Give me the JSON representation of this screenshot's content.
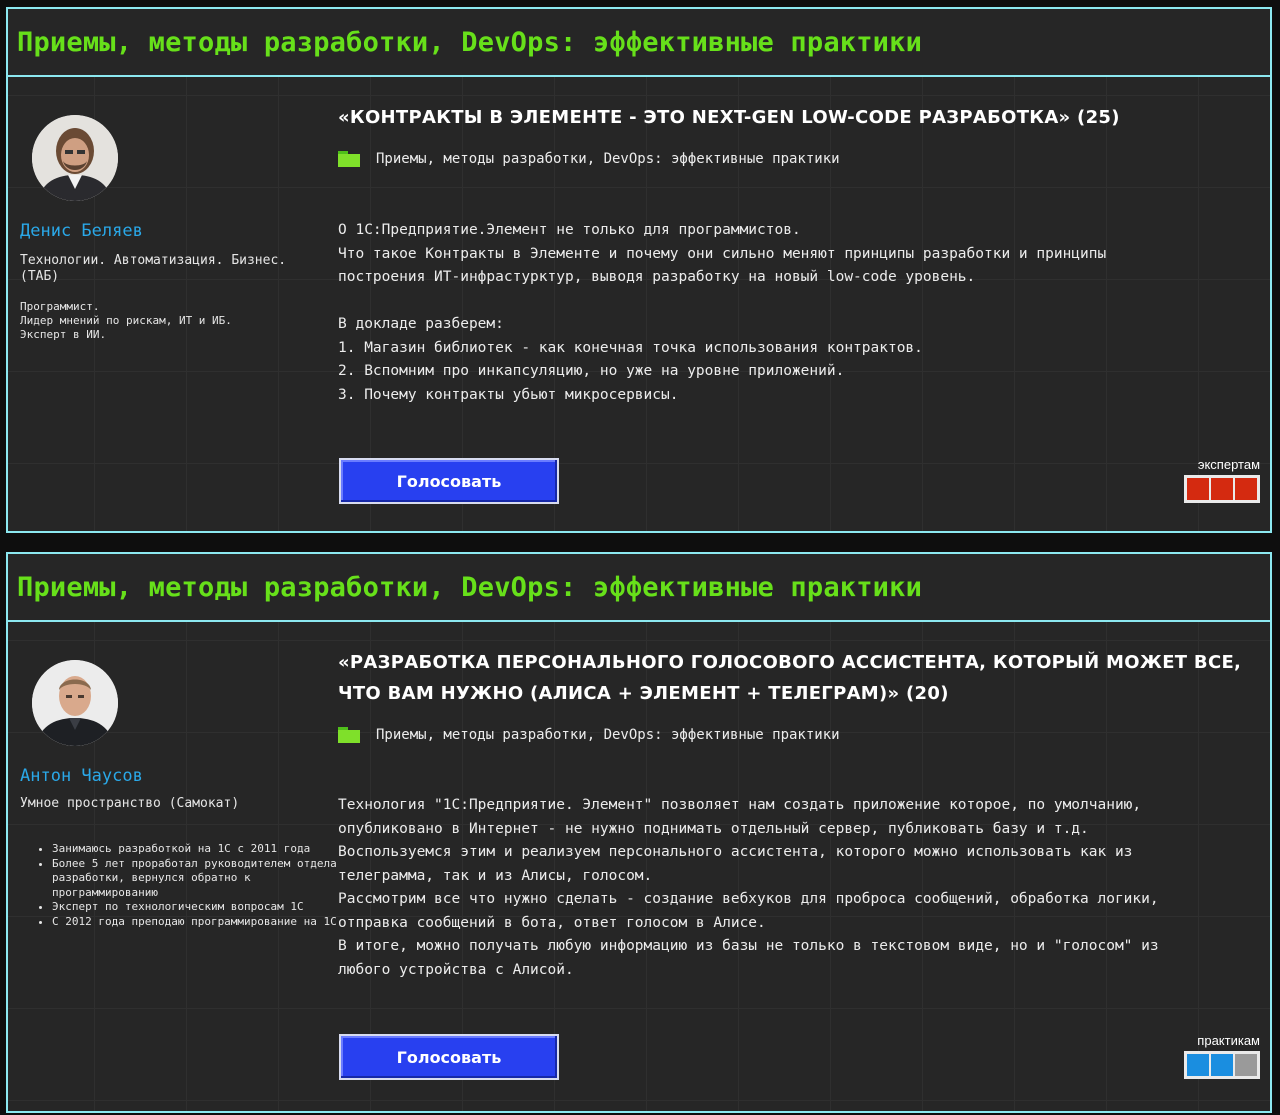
{
  "cards": [
    {
      "header": "Приемы, методы разработки, DevOps: эффективные практики",
      "speaker": {
        "name": "Денис Беляев",
        "company": "Технологии. Автоматизация. Бизнес. (ТАБ)",
        "bio_lines": [
          "Программист.",
          "Лидер мнений по рискам, ИТ и ИБ.",
          "Эксперт в ИИ."
        ]
      },
      "talk": {
        "title": "«КОНТРАКТЫ В ЭЛЕМЕНТЕ - ЭТО NEXT-GEN LOW-CODE РАЗРАБОТКА» (25)",
        "category": "Приемы, методы разработки, DevOps: эффективные практики",
        "description": [
          "О 1С:Предприятие.Элемент не только для программистов.",
          "Что такое Контракты в Элементе и почему они сильно меняют принципы разработки и принципы",
          "построения ИТ-инфрастурктур, выводя разработку на новый low-code уровень.",
          "",
          "В докладе разберем:",
          "1. Магазин библиотек - как конечная точка использования контрактов.",
          "2. Вспомним про инкапсуляцию, но уже на уровне приложений.",
          "3. Почему контракты убьют микросервисы."
        ]
      },
      "vote_label": "Голосовать",
      "rating": {
        "label": "экспертам",
        "colors": [
          "#d42a10",
          "#d42a10",
          "#d42a10"
        ]
      }
    },
    {
      "header": "Приемы, методы разработки, DevOps: эффективные практики",
      "speaker": {
        "name": "Антон Чаусов",
        "company": "Умное пространство (Самокат)",
        "bio_items": [
          "Занимаюсь разработкой на 1С с 2011 года",
          "Более 5 лет проработал руководителем отдела разработки, вернулся обратно к программированию",
          "Эксперт по технологическим вопросам 1С",
          "С 2012 года преподаю программирование на 1С"
        ]
      },
      "talk": {
        "title": "«РАЗРАБОТКА ПЕРСОНАЛЬНОГО ГОЛОСОВОГО АССИСТЕНТА, КОТОРЫЙ МОЖЕТ ВСЕ, ЧТО ВАМ НУЖНО (АЛИСА + ЭЛЕМЕНТ + ТЕЛЕГРАМ)» (20)",
        "category": "Приемы, методы разработки, DevOps: эффективные практики",
        "description": [
          "Технология \"1С:Предприятие. Элемент\" позволяет нам создать приложение которое, по умолчанию,",
          "опубликовано в Интернет - не нужно поднимать отдельный сервер, публиковать базу и т.д.",
          "Воспользуемся этим и реализуем персонального ассистента, которого можно использовать как из",
          "телеграмма, так и из Алисы, голосом.",
          "Рассмотрим все что нужно сделать - создание вебхуков для проброса сообщений, обработка логики,",
          "отправка сообщений в бота, ответ голосом в Алисе.",
          "В итоге, можно получать любую информацию из базы не только в текстовом виде, но и \"голосом\" из",
          "любого устройства с Алисой."
        ]
      },
      "vote_label": "Голосовать",
      "rating": {
        "label": "практикам",
        "colors": [
          "#1a8ee0",
          "#1a8ee0",
          "#9a9a9a"
        ]
      }
    }
  ]
}
